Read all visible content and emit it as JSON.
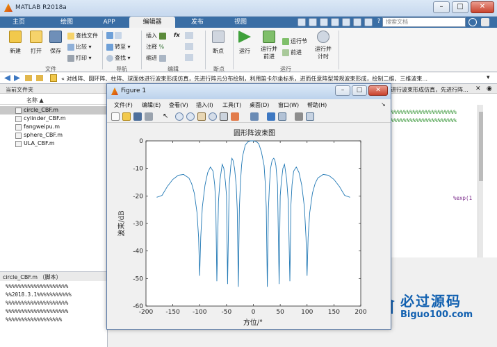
{
  "window": {
    "title": "MATLAB R2018a",
    "buttons": {
      "minimize": "–",
      "maximize": "□",
      "close": "✕"
    }
  },
  "tabs": [
    "主页",
    "绘图",
    "APP",
    "编辑器",
    "发布",
    "视图"
  ],
  "search": {
    "placeholder": "搜索文档"
  },
  "ribbon": {
    "file": {
      "label": "文件",
      "new": "新建",
      "open": "打开",
      "save": "保存",
      "find_files": "查找文件",
      "compare": "比较",
      "print": "打印"
    },
    "navigate": {
      "label": "导航",
      "goto": "转至",
      "find": "查找"
    },
    "edit": {
      "label": "编辑",
      "insert": "插入",
      "comment": "注释",
      "indent": "缩进",
      "fx": "fx"
    },
    "breakpoints": {
      "label": "断点",
      "breakpoint": "断点"
    },
    "run": {
      "label": "运行",
      "run": "运行",
      "run_advance_1": "运行并",
      "run_advance_2": "前进",
      "run_section": "运行节",
      "advance": "前进",
      "run_time_1": "运行并",
      "run_time_2": "计时"
    }
  },
  "address": {
    "text": "« 对线阵、圆环阵、柱阵、球面体进行波束形成仿真，先进行阵元分布绘制，利用笛卡尔坐标系，进而任意阵型常规波束形成，绘制二维、三维波束..."
  },
  "left_panel": {
    "title": "当前文件夹",
    "column": "名称 ▲",
    "files": [
      "circle_CBF.m",
      "cylinder_CBF.m",
      "fangweipu.m",
      "sphere_CBF.m",
      "ULA_CBF.m"
    ]
  },
  "details_panel": {
    "title": "circle_CBF.m （脚本）",
    "lines": [
      "%%%%%%%%%%%%%%%%%%%%",
      "%%2018.3.1%%%%%%%%%%%",
      "%%%%%%%%%%%%%%%%%%%%",
      "%%%%%%%%%%%%%%%%%%%%",
      "%%%%%%%%%%%%%%%%%%"
    ]
  },
  "right_editor": {
    "header_text": "进行波束形成仿真，先进行阵...",
    "code_lines": [
      "%%%%%%%%%%%%%%%%%%%%%",
      "%%%%%%%%%%%%%%%%%%%%%"
    ],
    "exp_text": "%exp(1"
  },
  "watermark": {
    "title": "必过源码",
    "url": "Biguo100.com"
  },
  "figure": {
    "title": "Figure 1",
    "menus": [
      "文件(F)",
      "编辑(E)",
      "查看(V)",
      "插入(I)",
      "工具(T)",
      "桌面(D)",
      "窗口(W)",
      "帮助(H)"
    ]
  },
  "colors": {
    "line": "#1f77b4",
    "tab_bar": "#3a6ea5",
    "watermark": "#1160b0"
  },
  "chart_data": {
    "type": "line",
    "title": "圆形阵波束图",
    "xlabel": "方位/°",
    "ylabel": "波束/dB",
    "xlim": [
      -200,
      200
    ],
    "ylim": [
      -60,
      0
    ],
    "xticks": [
      -200,
      -150,
      -100,
      -50,
      0,
      50,
      100,
      150,
      200
    ],
    "yticks": [
      0,
      -10,
      -20,
      -30,
      -40,
      -50,
      -60
    ],
    "grid": false,
    "series": [
      {
        "x": [
          -180,
          -170,
          -160,
          -150,
          -140,
          -130,
          -120,
          -115,
          -110,
          -105,
          -102,
          -100,
          -98,
          -95,
          -90,
          -85,
          -80,
          -75,
          -72,
          -70,
          -68,
          -65,
          -62,
          -58,
          -55,
          -52,
          -50,
          -48,
          -45,
          -42,
          -40,
          -38,
          -35,
          -32,
          -30,
          -28,
          -26,
          -24,
          -22,
          -20,
          -15,
          -10,
          -5,
          0,
          5,
          10,
          15,
          20,
          22,
          24,
          26,
          28,
          30,
          32,
          35,
          38,
          40,
          42,
          45,
          48,
          50,
          52,
          55,
          58,
          62,
          65,
          68,
          70,
          72,
          75,
          80,
          85,
          90,
          95,
          98,
          100,
          102,
          105,
          110,
          115,
          120,
          130,
          140,
          150,
          160,
          170,
          180
        ],
        "y": [
          -20.5,
          -19.8,
          -16.5,
          -14.0,
          -12.5,
          -12.2,
          -13.5,
          -15.5,
          -19,
          -26,
          -35,
          -49,
          -35,
          -24,
          -16,
          -11.5,
          -9.5,
          -11,
          -16,
          -23,
          -51,
          -22,
          -14,
          -8.5,
          -10,
          -15,
          -20,
          -52,
          -16,
          -9,
          -6.3,
          -7,
          -10,
          -16,
          -25,
          -53,
          -24,
          -15,
          -9,
          -5.5,
          -1.5,
          -0.3,
          0,
          0,
          -0.2,
          -1,
          -4,
          -9,
          -15,
          -24,
          -53,
          -25,
          -16,
          -10,
          -7,
          -6.3,
          -7,
          -9,
          -16,
          -52,
          -20,
          -15,
          -10,
          -8.5,
          -14,
          -22,
          -51,
          -23,
          -16,
          -11,
          -9.5,
          -11.5,
          -16,
          -24,
          -35,
          -49,
          -35,
          -26,
          -19,
          -15.5,
          -13.5,
          -12.2,
          -12.5,
          -14.0,
          -16.5,
          -19.8,
          -20.5
        ]
      }
    ]
  }
}
